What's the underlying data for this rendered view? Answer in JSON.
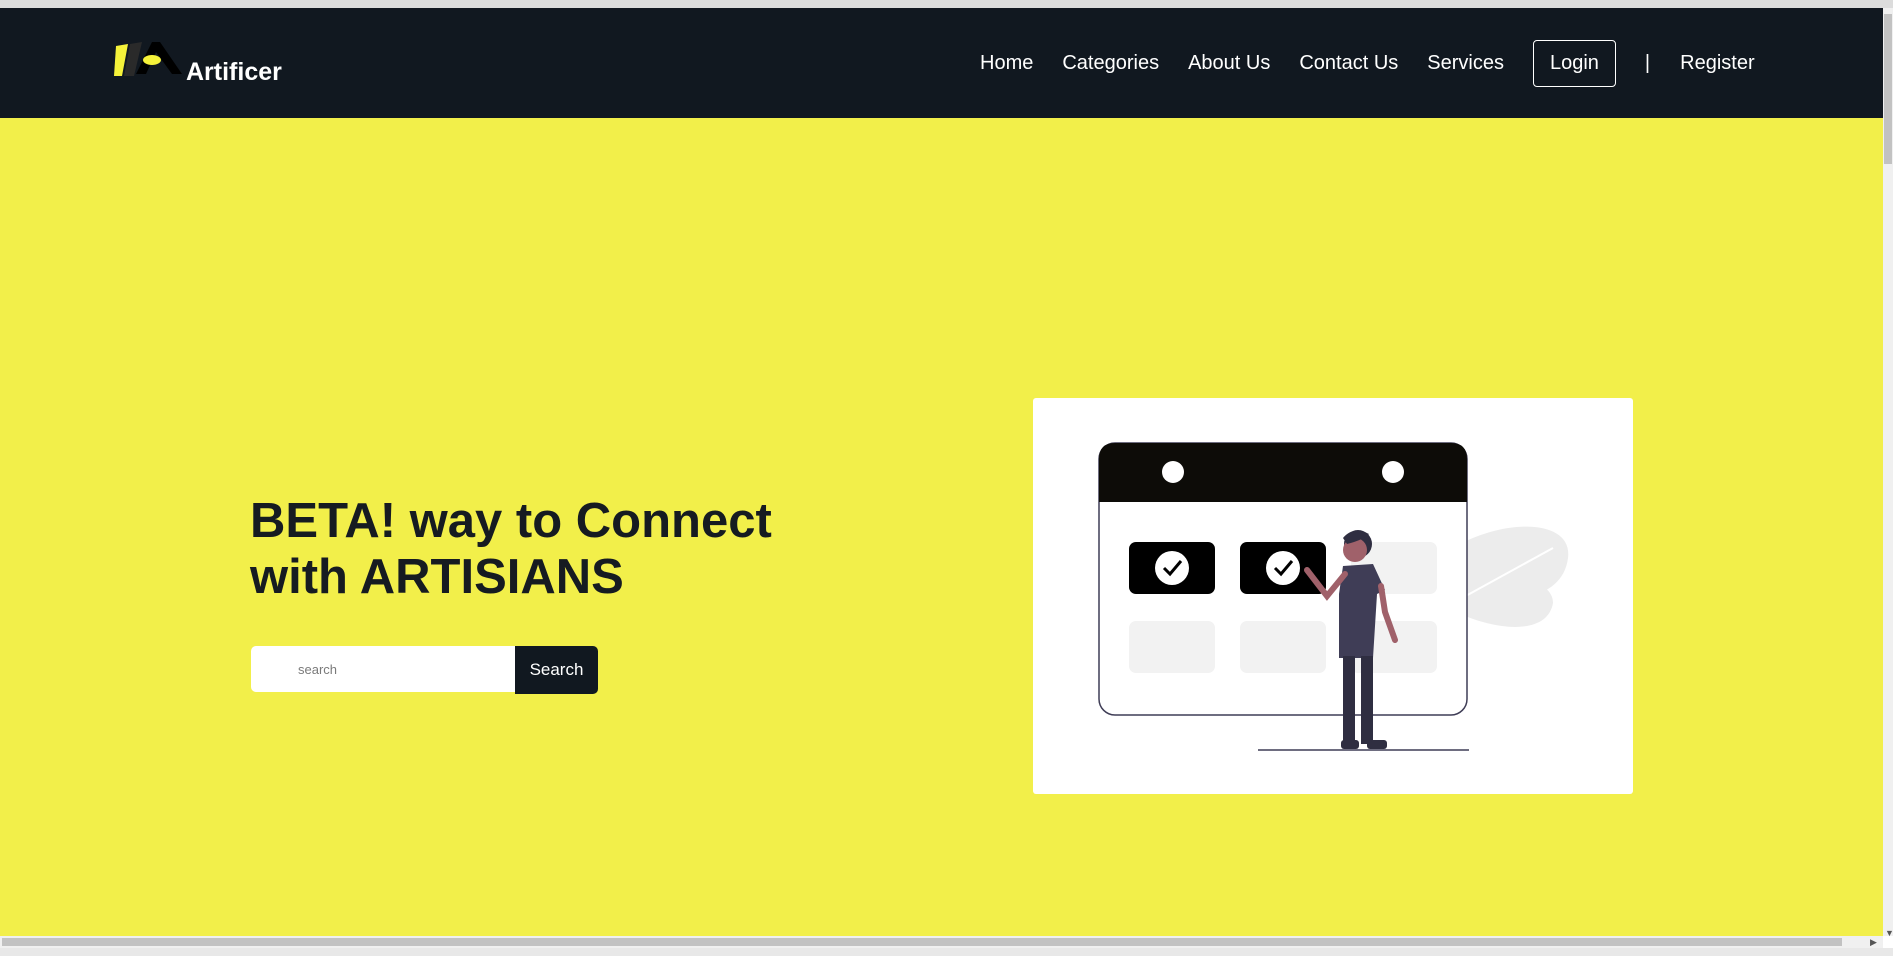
{
  "brand": {
    "name": "Artificer",
    "logo_icon": "artificer-logo-icon",
    "colors": {
      "nav_bg": "#111820",
      "hero_bg": "#f2ef4a",
      "accent_yellow": "#f5f23a"
    }
  },
  "nav": {
    "items": [
      {
        "label": "Home"
      },
      {
        "label": "Categories"
      },
      {
        "label": "About Us"
      },
      {
        "label": "Contact Us"
      },
      {
        "label": "Services"
      }
    ],
    "login_label": "Login",
    "separator": "|",
    "register_label": "Register"
  },
  "hero": {
    "headline_line1": "BETA! way to Connect",
    "headline_line2": "with ARTISIANS",
    "search": {
      "placeholder": "search",
      "value": "",
      "button_label": "Search"
    },
    "illustration": "calendar-checklist-illustration"
  }
}
